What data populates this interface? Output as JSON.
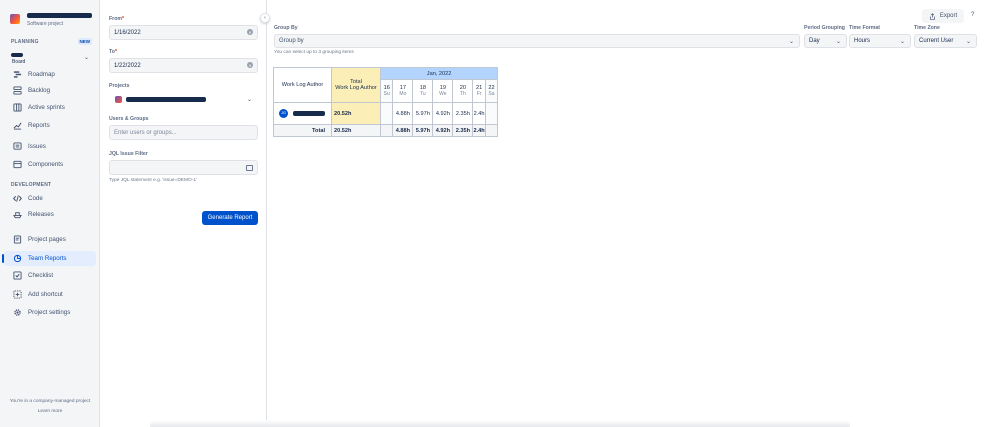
{
  "sidebar": {
    "project_type": "Software project",
    "planning_title": "PLANNING",
    "new_badge": "NEW",
    "board_label": "Board",
    "development_title": "DEVELOPMENT",
    "items": {
      "roadmap": "Roadmap",
      "backlog": "Backlog",
      "active_sprints": "Active sprints",
      "reports": "Reports",
      "issues": "Issues",
      "components": "Components",
      "code": "Code",
      "releases": "Releases",
      "project_pages": "Project pages",
      "team_reports": "Team Reports",
      "checklist": "Checklist",
      "add_shortcut": "Add shortcut",
      "project_settings": "Project settings"
    },
    "footer_note": "You're in a company-managed project",
    "learn_more": "Learn more"
  },
  "filters": {
    "from_label": "From",
    "from_value": "1/16/2022",
    "to_label": "To",
    "to_value": "1/22/2022",
    "projects_label": "Projects",
    "users_label": "Users & Groups",
    "users_placeholder": "Enter users or groups...",
    "jql_label": "JQL Issue Filter",
    "jql_hint": "Type JQL statement e.g. 'issue=DEMO-1'",
    "generate_label": "Generate Report",
    "required_mark": "*"
  },
  "main": {
    "export_label": "Export",
    "help": "?",
    "group_by_label": "Group By",
    "group_by_placeholder": "Group by",
    "group_hint": "You can select up to 3 grouping items",
    "period_label": "Period Grouping",
    "period_value": "Day",
    "format_label": "Time Format",
    "format_value": "Hours",
    "tz_label": "Time Zone",
    "tz_value": "Current User"
  },
  "report": {
    "author_header": "Work Log Author",
    "total_header_1": "Total",
    "total_header_2": "Work Log Author",
    "month": "Jan, 2022",
    "days": [
      {
        "num": "16",
        "wd": "Su"
      },
      {
        "num": "17",
        "wd": "Mo"
      },
      {
        "num": "18",
        "wd": "Tu"
      },
      {
        "num": "19",
        "wd": "We"
      },
      {
        "num": "20",
        "wd": "Th"
      },
      {
        "num": "21",
        "wd": "Fr"
      },
      {
        "num": "22",
        "wd": "Sa"
      }
    ],
    "row": {
      "initials": "JG",
      "total": "20.52h",
      "values": [
        "",
        "4.88h",
        "5.97h",
        "4.92h",
        "2.35h",
        "2.4h",
        ""
      ]
    },
    "totals": {
      "label": "Total",
      "total": "20.52h",
      "values": [
        "",
        "4.88h",
        "5.97h",
        "4.92h",
        "2.35h",
        "2.4h",
        ""
      ]
    }
  }
}
